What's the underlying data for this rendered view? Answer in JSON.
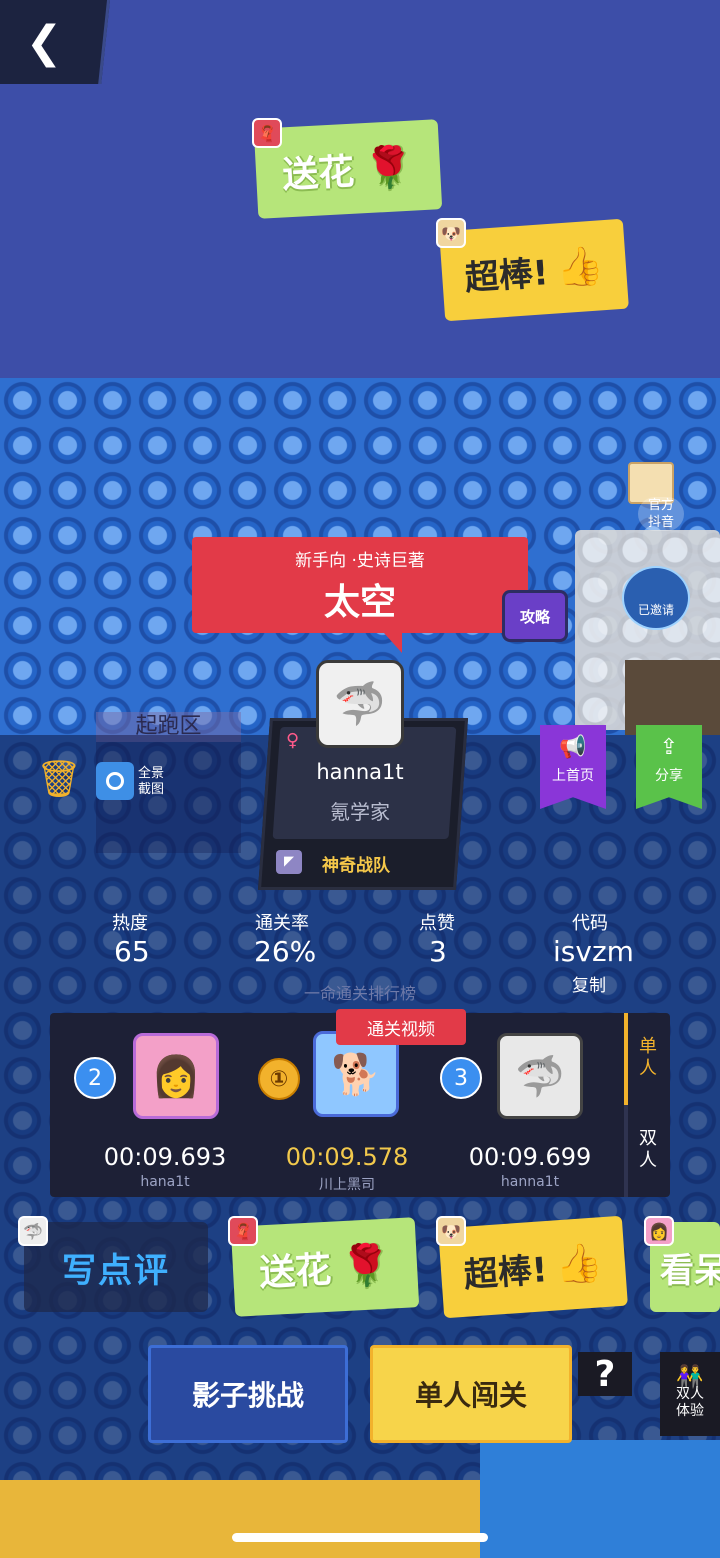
{
  "nav": {
    "back_icon": "chevron-left-icon",
    "back_glyph": "❮"
  },
  "floating_stickers": [
    {
      "label": "送花",
      "emoji": "🌹",
      "avatar": "🧣"
    },
    {
      "label": "超棒!",
      "emoji": "👍",
      "avatar": "🐶"
    }
  ],
  "level": {
    "subtitle": "新手向 ·史诗巨著",
    "title": "太空",
    "guide_label": "攻略",
    "start_zone": "起跑区"
  },
  "side": {
    "official_label": "官方\n抖音",
    "invited_label": "已邀请"
  },
  "toolbar": {
    "screenshot_label": "全景\n截图",
    "trash_icon": "trash-icon",
    "camera_icon": "camera-icon"
  },
  "profile": {
    "gender": "♀",
    "name": "hanna1t",
    "role": "氪学家",
    "team_name": "神奇战队",
    "avatar_emoji": "🦈"
  },
  "actions": {
    "homepage_label": "上首页",
    "share_label": "分享",
    "homepage_icon": "megaphone-icon",
    "share_icon": "share-icon"
  },
  "stats": [
    {
      "label": "热度",
      "value": "65"
    },
    {
      "label": "通关率",
      "value": "26%"
    },
    {
      "label": "点赞",
      "value": "3"
    },
    {
      "label": "代码",
      "value": "isvzm",
      "action": "复制"
    }
  ],
  "leaderboard": {
    "title": "一命通关排行榜",
    "video_tag": "通关视频",
    "modes": [
      "单人",
      "双人"
    ],
    "entries": [
      {
        "rank": "2",
        "time": "00:09.693",
        "name": "hana1t",
        "avatar": "👩"
      },
      {
        "rank": "①",
        "time": "00:09.578",
        "name": "川上黑司",
        "avatar": "🐕"
      },
      {
        "rank": "3",
        "time": "00:09.699",
        "name": "hanna1t",
        "avatar": "🦈"
      }
    ]
  },
  "comment": {
    "label": "写点评",
    "avatar": "🦈"
  },
  "quick_stickers": [
    {
      "label": "送花",
      "emoji": "🌹",
      "avatar": "🧣"
    },
    {
      "label": "超棒!",
      "emoji": "👍",
      "avatar": "🐶"
    },
    {
      "label": "看呆",
      "avatar": "👩"
    }
  ],
  "bottom": {
    "shadow_challenge": "影子挑战",
    "single_play": "单人闯关",
    "help": "?",
    "duo_label": "双人\n体验"
  },
  "colors": {
    "accent_red": "#e23a48",
    "gold": "#f2b22c",
    "sticker_green": "#b6e57a",
    "sticker_yellow": "#f8cf3c",
    "panel_dark": "#1d2036"
  }
}
